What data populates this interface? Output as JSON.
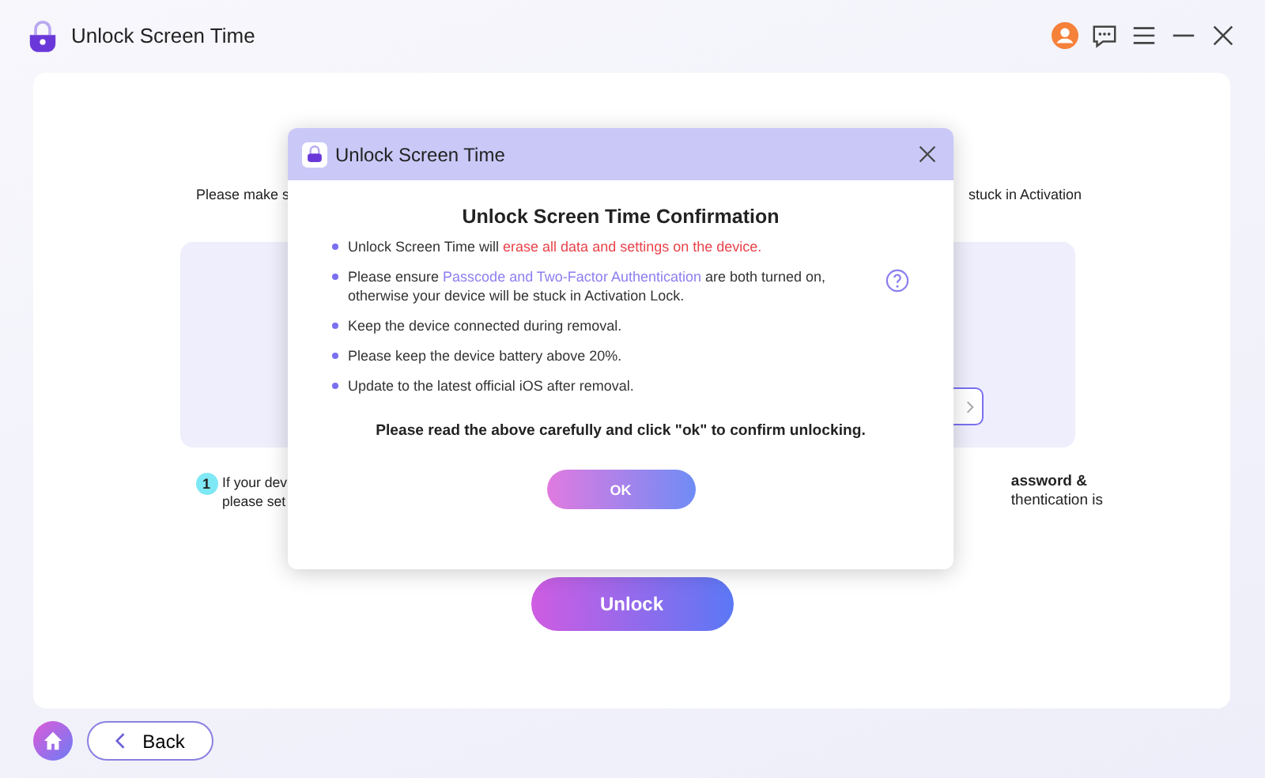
{
  "window": {
    "title": "Unlock Screen Time"
  },
  "background": {
    "notice_left": "Please make s",
    "notice_right": "stuck in Activation",
    "step_number": "1",
    "step_left": [
      "If your dev",
      "please set"
    ],
    "step_right": [
      "assword &",
      "thentication is"
    ],
    "unlock_button": "Unlock"
  },
  "dialog": {
    "title": "Unlock Screen Time",
    "heading": "Unlock Screen Time Confirmation",
    "bullets": [
      {
        "parts": [
          {
            "kind": "plain",
            "text": "Unlock Screen Time will "
          },
          {
            "kind": "warning",
            "text": "erase all data and settings on the device."
          }
        ],
        "help": false
      },
      {
        "parts": [
          {
            "kind": "plain",
            "text": "Please ensure "
          },
          {
            "kind": "highlight",
            "text": "Passcode and Two-Factor Authentication"
          },
          {
            "kind": "plain",
            "text": " are both turned on, otherwise your device will be stuck in Activation Lock."
          }
        ],
        "help": true
      },
      {
        "parts": [
          {
            "kind": "plain",
            "text": "Keep the device connected during removal."
          }
        ],
        "help": false
      },
      {
        "parts": [
          {
            "kind": "plain",
            "text": "Please keep the device battery above 20%."
          }
        ],
        "help": false
      },
      {
        "parts": [
          {
            "kind": "plain",
            "text": "Update to the latest official iOS after removal."
          }
        ],
        "help": false
      }
    ],
    "confirm_text": "Please read the above carefully and click \"ok\" to confirm unlocking.",
    "ok_button": "OK"
  },
  "footer": {
    "back_button": "Back"
  }
}
